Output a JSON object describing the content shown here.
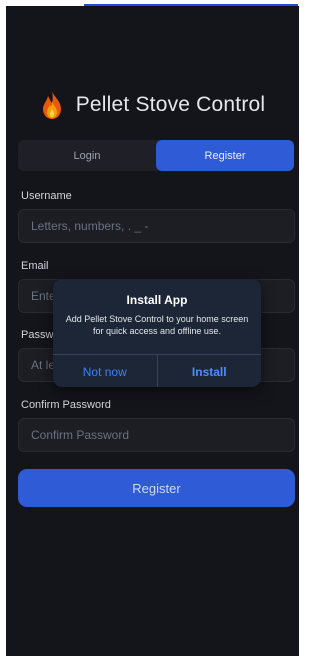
{
  "app": {
    "title": "Pellet Stove Control",
    "icon": "flame-icon"
  },
  "tabs": [
    {
      "label": "Login",
      "active": false
    },
    {
      "label": "Register",
      "active": true
    }
  ],
  "form": {
    "username": {
      "label": "Username",
      "placeholder": "Letters, numbers, . _ -",
      "value": ""
    },
    "email": {
      "label": "Email",
      "placeholder": "Enter your email",
      "value": ""
    },
    "password": {
      "label": "Password",
      "placeholder": "At least 8 characters",
      "value": ""
    },
    "confirm_password": {
      "label": "Confirm Password",
      "placeholder": "Confirm Password",
      "value": ""
    },
    "submit_label": "Register"
  },
  "install_dialog": {
    "title": "Install App",
    "message": "Add Pellet Stove Control to your home screen for quick access and offline use.",
    "dismiss_label": "Not now",
    "install_label": "Install"
  },
  "colors": {
    "background": "#14141b",
    "accent": "#2f5bd6",
    "dialog": "#1c2637",
    "flame": "#f59e0b"
  }
}
